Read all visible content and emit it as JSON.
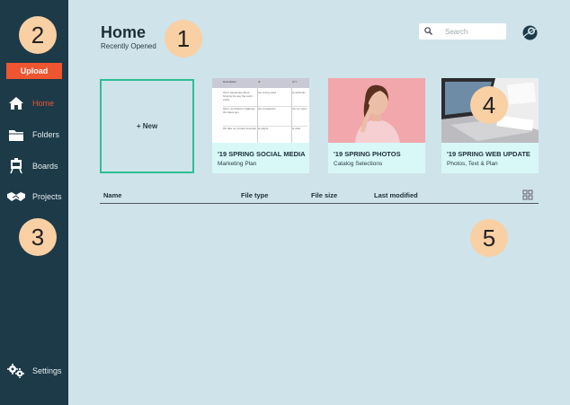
{
  "sidebar": {
    "upload_label": "Upload",
    "items": [
      {
        "label": "Home",
        "icon": "home-icon",
        "active": true
      },
      {
        "label": "Folders",
        "icon": "folder-icon",
        "active": false
      },
      {
        "label": "Boards",
        "icon": "board-icon",
        "active": false
      },
      {
        "label": "Projects",
        "icon": "handshake-icon",
        "active": false
      }
    ],
    "settings_label": "Settings"
  },
  "header": {
    "title": "Home",
    "subtitle": "Recently Opened",
    "search_placeholder": "Search"
  },
  "cards": {
    "new_label": "+ New",
    "items": [
      {
        "name": "'19 SPRING SOCIAL MEDIA",
        "sub": "Marketing Plan",
        "thumb": "spreadsheet"
      },
      {
        "name": "'19 SPRING PHOTOS",
        "sub": "Catalog Selections",
        "thumb": "portrait-photo"
      },
      {
        "name": "'19 SPRING WEB UPDATE",
        "sub": "Photos, Text & Plan",
        "thumb": "laptop-photo"
      }
    ]
  },
  "spreadsheet_thumb": {
    "headers": [
      "Description",
      "Kit",
      "Kit Y"
    ],
    "rows": [
      [
        "We're passionate about bringing the way the world works",
        "Use strong verbs",
        "Be authentic"
      ],
      [
        "We're not afraid to challenge the status quo",
        "Use compassion",
        "Use our voice"
      ],
      [
        "We take our product seriously",
        "Be playful",
        "Be clear"
      ]
    ]
  },
  "table": {
    "columns": [
      "Name",
      "File type",
      "File size",
      "Last modified"
    ]
  },
  "badges": [
    "1",
    "2",
    "3",
    "4",
    "5"
  ],
  "colors": {
    "sidebar": "#1d3a48",
    "accent": "#ee5530",
    "background": "#cfe3ea",
    "new_border": "#2dbf94",
    "card_bg": "#d8f8f8",
    "badge": "#f9cfa4"
  }
}
